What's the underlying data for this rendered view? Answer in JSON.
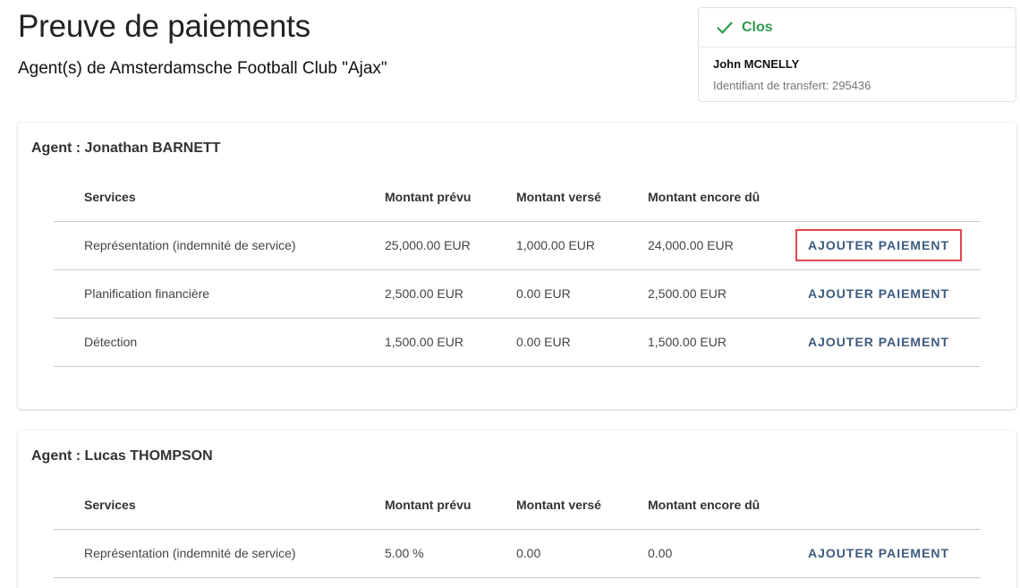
{
  "page": {
    "title": "Preuve de paiements",
    "subtitle": "Agent(s) de Amsterdamsche Football Club \"Ajax\""
  },
  "status_card": {
    "status": "Clos",
    "name": "John MCNELLY",
    "transfer_id": "Identifiant de transfert: 295436",
    "status_color": "#2e9b4f"
  },
  "table_headers": {
    "services": "Services",
    "planned": "Montant prévu",
    "paid": "Montant versé",
    "due": "Montant encore dû"
  },
  "agents": [
    {
      "title": "Agent : Jonathan BARNETT",
      "rows": [
        {
          "service": "Représentation (indemnité de service)",
          "planned": "25,000.00 EUR",
          "paid": "1,000.00 EUR",
          "due": "24,000.00 EUR",
          "action": "AJOUTER PAIEMENT"
        },
        {
          "service": "Planification financière",
          "planned": "2,500.00 EUR",
          "paid": "0.00 EUR",
          "due": "2,500.00 EUR",
          "action": "AJOUTER PAIEMENT"
        },
        {
          "service": "Détection",
          "planned": "1,500.00 EUR",
          "paid": "0.00 EUR",
          "due": "1,500.00 EUR",
          "action": "AJOUTER PAIEMENT"
        }
      ]
    },
    {
      "title": "Agent : Lucas THOMPSON",
      "rows": [
        {
          "service": "Représentation (indemnité de service)",
          "planned": "5.00 %",
          "paid": "0.00",
          "due": "0.00",
          "action": "AJOUTER PAIEMENT"
        }
      ]
    }
  ],
  "colors": {
    "accent_link": "#3d5a80",
    "highlight_border": "#e0474c"
  }
}
